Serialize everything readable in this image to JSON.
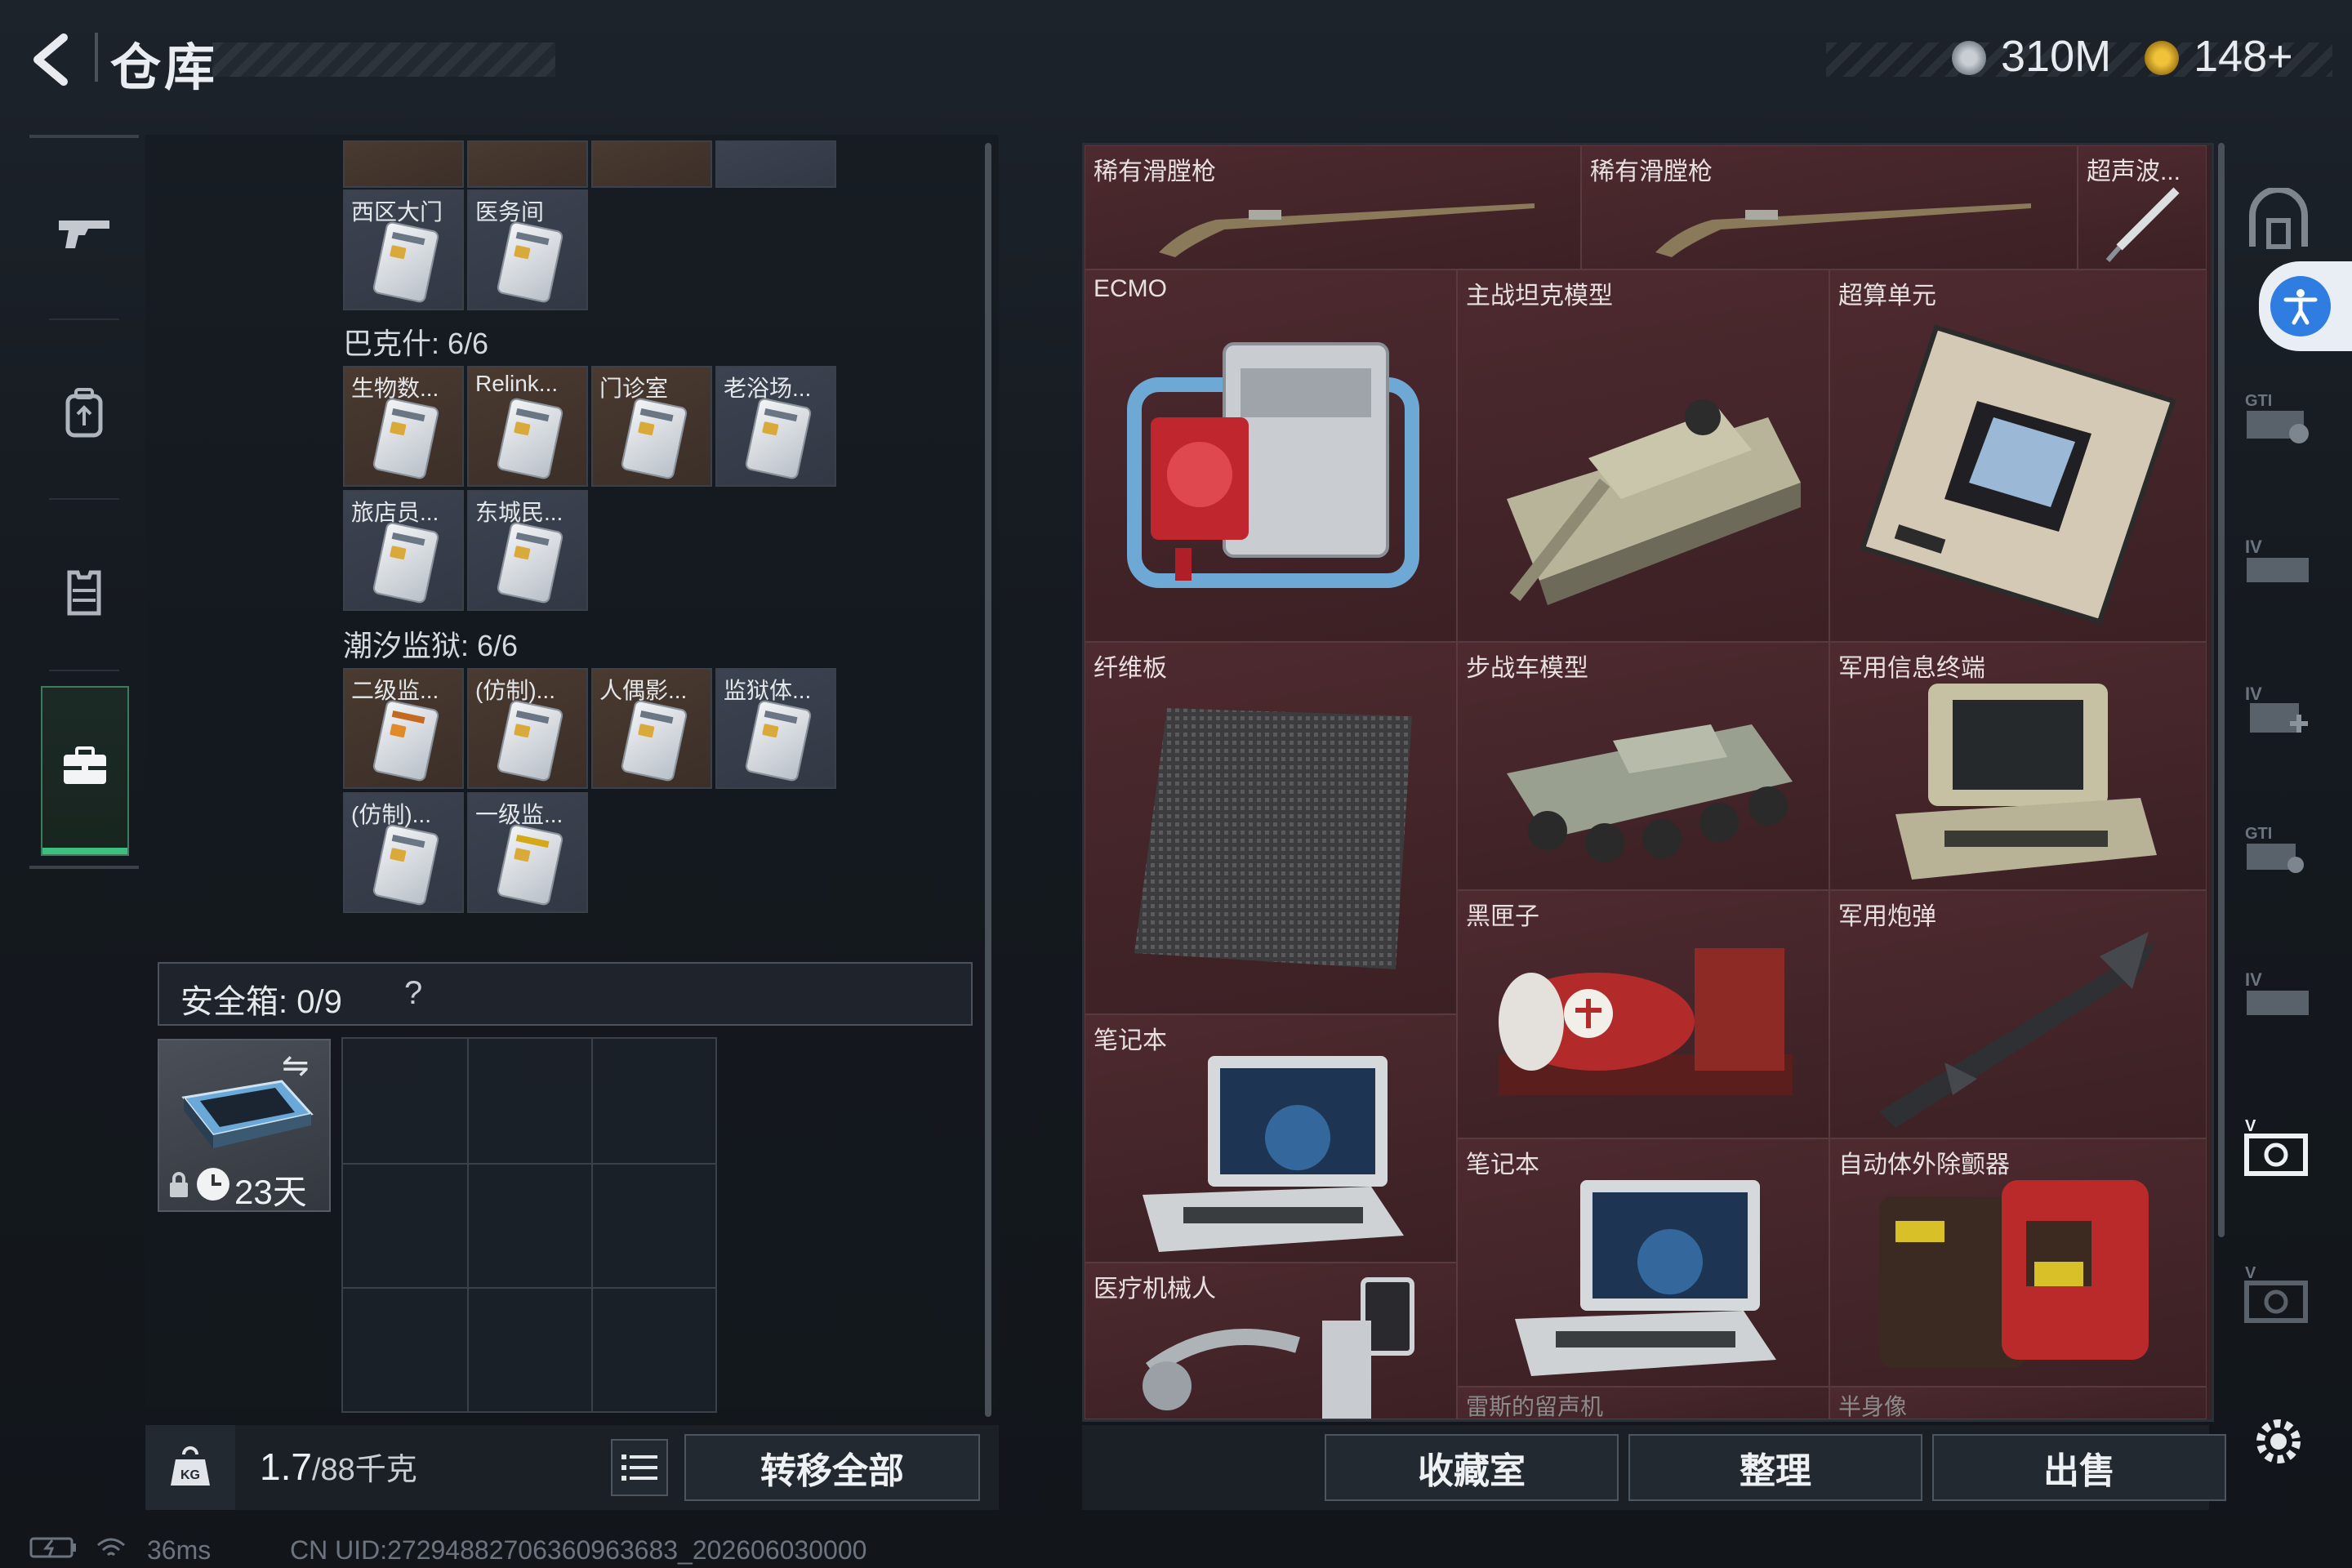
{
  "header": {
    "title": "仓库",
    "currency_silver": "310M",
    "currency_gold": "148+"
  },
  "left_rail": {
    "items": [
      {
        "name": "weapon"
      },
      {
        "name": "backpack"
      },
      {
        "name": "vest"
      },
      {
        "name": "case",
        "active": true
      }
    ]
  },
  "keycards": {
    "top_row_labels": [
      "西区大门",
      "医务间"
    ],
    "bakshi": {
      "title": "巴克什: 6/6",
      "cards": [
        "生物数...",
        "Relink...",
        "门诊室",
        "老浴场...",
        "旅店员...",
        "东城民..."
      ]
    },
    "tide_prison": {
      "title": "潮汐监狱: 6/6",
      "cards": [
        "二级监...",
        "(仿制)...",
        "人偶影...",
        "监狱体...",
        "(仿制)...",
        "一级监..."
      ]
    }
  },
  "safe_box": {
    "title": "安全箱: 0/9",
    "help": "?",
    "case_timer": "23天"
  },
  "weight": {
    "current": "1.7",
    "max": "/88千克"
  },
  "left_buttons": {
    "transfer_all": "转移全部"
  },
  "warehouse_items": [
    {
      "label": "稀有滑膛枪",
      "kind": "musket"
    },
    {
      "label": "稀有滑膛枪",
      "kind": "musket"
    },
    {
      "label": "超声波...",
      "kind": "scalpel"
    },
    {
      "label": "ECMO",
      "kind": "ecmo"
    },
    {
      "label": "主战坦克模型",
      "kind": "tank"
    },
    {
      "label": "超算单元",
      "kind": "board"
    },
    {
      "label": "纤维板",
      "kind": "fiber"
    },
    {
      "label": "步战车模型",
      "kind": "ifv"
    },
    {
      "label": "军用信息终端",
      "kind": "terminal"
    },
    {
      "label": "黑匣子",
      "kind": "blackbox"
    },
    {
      "label": "军用炮弹",
      "kind": "missile"
    },
    {
      "label": "笔记本",
      "kind": "laptop"
    },
    {
      "label": "笔记本",
      "kind": "laptop"
    },
    {
      "label": "自动体外除颤器",
      "kind": "aed"
    },
    {
      "label": "医疗机械人",
      "kind": "robot"
    },
    {
      "label": "雷斯的留声机",
      "kind": "partial"
    },
    {
      "label": "半身像",
      "kind": "partial"
    }
  ],
  "bottom_buttons": {
    "collection": "收藏室",
    "sort": "整理",
    "sell": "出售"
  },
  "right_rail": {
    "items": [
      "home",
      "accessibility",
      "gti-1",
      "iv-1",
      "iv-plus",
      "gti-2",
      "iv-2",
      "v-1",
      "v-2",
      "settings"
    ]
  },
  "status_bar": {
    "ping": "36ms",
    "uid": "CN UID:27294882706360963683_202606030000"
  },
  "colors": {
    "warehouse_bg": "#3a2125",
    "active_rail": "#3fbf7f",
    "accent_blue": "#2f7de1"
  }
}
